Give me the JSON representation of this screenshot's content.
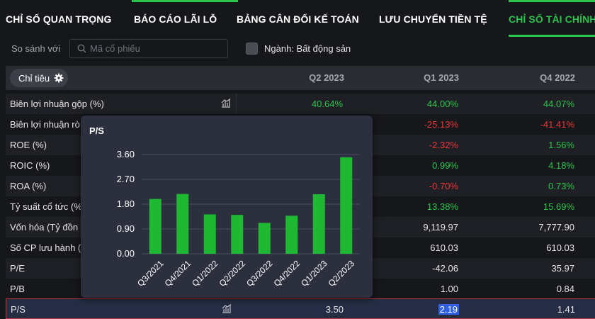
{
  "tabs": [
    {
      "label": "CHỈ SỐ QUAN TRỌNG",
      "active": false
    },
    {
      "label": "BÁO CÁO LÃI LỖ",
      "active": false
    },
    {
      "label": "BẢNG CÂN ĐỐI KẾ TOÁN",
      "active": false
    },
    {
      "label": "LƯU CHUYỂN TIỀN TỆ",
      "active": false
    },
    {
      "label": "CHỈ SỐ TÀI CHÍNH",
      "active": true
    }
  ],
  "compare": {
    "label": "So sánh với",
    "search_placeholder": "Mã cổ phiếu",
    "industry_label": "Ngành: Bất động sản"
  },
  "table": {
    "metric_button": "Chỉ tiêu",
    "columns": [
      "Q2 2023",
      "Q1 2023",
      "Q4 2022"
    ],
    "rows": [
      {
        "label": "Biên lợi nhuận gộp (%)",
        "values": [
          "40.64%",
          "44.00%",
          "44.07%"
        ],
        "colors": [
          "green",
          "green",
          "green"
        ],
        "chart_icon": true
      },
      {
        "label": "Biên lợi nhuận rò",
        "values": [
          "",
          "-25.13%",
          "-41.41%"
        ],
        "colors": [
          "",
          "red",
          "red"
        ],
        "chart_icon": false
      },
      {
        "label": "ROE (%)",
        "values": [
          "",
          "-2.32%",
          "1.56%"
        ],
        "colors": [
          "",
          "red",
          "green"
        ],
        "chart_icon": false
      },
      {
        "label": "ROIC (%)",
        "values": [
          "",
          "0.99%",
          "4.18%"
        ],
        "colors": [
          "",
          "green",
          "green"
        ],
        "chart_icon": false
      },
      {
        "label": "ROA (%)",
        "values": [
          "",
          "-0.70%",
          "0.73%"
        ],
        "colors": [
          "",
          "red",
          "green"
        ],
        "chart_icon": false
      },
      {
        "label": "Tỷ suất cổ tức (%",
        "values": [
          "",
          "13.38%",
          "15.69%"
        ],
        "colors": [
          "",
          "green",
          "green"
        ],
        "chart_icon": false
      },
      {
        "label": "Vốn hóa (Tỷ đồn",
        "values": [
          "",
          "9,119.97",
          "7,777.90"
        ],
        "colors": [
          "",
          "",
          ""
        ],
        "chart_icon": false
      },
      {
        "label": "Số CP lưu hành (",
        "values": [
          "",
          "610.03",
          "610.03"
        ],
        "colors": [
          "",
          "",
          ""
        ],
        "chart_icon": false
      },
      {
        "label": "P/E",
        "values": [
          "",
          "-42.06",
          "35.97"
        ],
        "colors": [
          "",
          "",
          ""
        ],
        "chart_icon": false
      },
      {
        "label": "P/B",
        "values": [
          "",
          "1.00",
          "0.84"
        ],
        "colors": [
          "",
          "",
          ""
        ],
        "chart_icon": false
      }
    ],
    "highlight_row": {
      "label": "P/S",
      "values": [
        "3.50",
        "2.19",
        "1.41"
      ],
      "selected_index": 1
    }
  },
  "chart_data": {
    "type": "bar",
    "title": "P/S",
    "categories": [
      "Q3/2021",
      "Q4/2021",
      "Q1/2022",
      "Q2/2022",
      "Q3/2022",
      "Q4/2022",
      "Q1/2023",
      "Q2/2023"
    ],
    "values": [
      1.99,
      2.17,
      1.43,
      1.41,
      1.12,
      1.38,
      2.16,
      3.5
    ],
    "yticks": [
      "0.00",
      "0.90",
      "1.80",
      "2.70",
      "3.60"
    ],
    "ylim": [
      0,
      3.6
    ],
    "grid": true,
    "bar_color": "#1fb832"
  },
  "colors": {
    "accent_green": "#2bc44c",
    "negative_red": "#e8363a",
    "highlight_border": "#c5393d"
  }
}
